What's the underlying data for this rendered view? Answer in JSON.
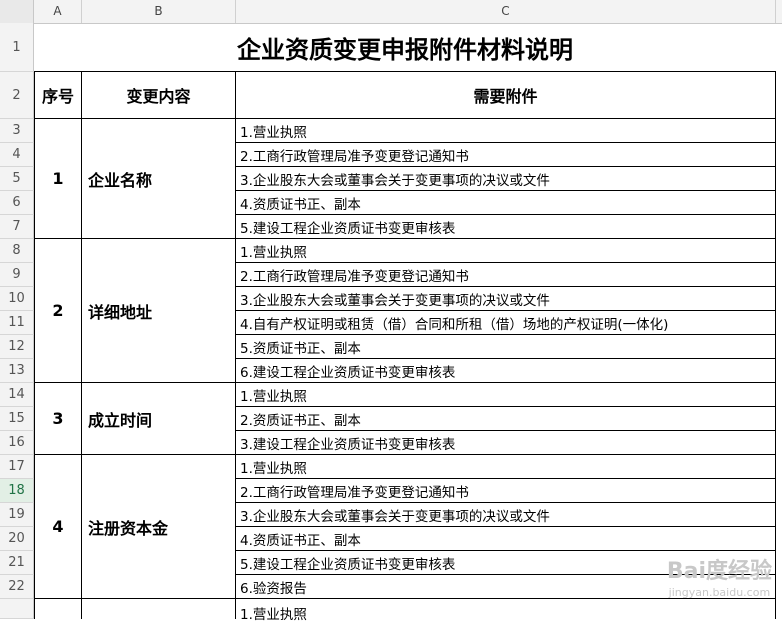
{
  "columns": [
    "A",
    "B",
    "C"
  ],
  "row_numbers": [
    "1",
    "2",
    "3",
    "4",
    "5",
    "6",
    "7",
    "8",
    "9",
    "10",
    "11",
    "12",
    "13",
    "14",
    "15",
    "16",
    "17",
    "18",
    "19",
    "20",
    "21",
    "22"
  ],
  "selected_row": "18",
  "title": "企业资质变更申报附件材料说明",
  "headers": {
    "idx": "序号",
    "content": "变更内容",
    "attach": "需要附件"
  },
  "groups": [
    {
      "idx": "1",
      "name": "企业名称",
      "items": [
        "1.营业执照",
        "2.工商行政管理局准予变更登记通知书",
        "3.企业股东大会或董事会关于变更事项的决议或文件",
        "4.资质证书正、副本",
        "5.建设工程企业资质证书变更审核表"
      ]
    },
    {
      "idx": "2",
      "name": "详细地址",
      "items": [
        "1.营业执照",
        "2.工商行政管理局准予变更登记通知书",
        "3.企业股东大会或董事会关于变更事项的决议或文件",
        "4.自有产权证明或租赁（借）合同和所租（借）场地的产权证明(一体化)",
        "5.资质证书正、副本",
        "6.建设工程企业资质证书变更审核表"
      ]
    },
    {
      "idx": "3",
      "name": "成立时间",
      "items": [
        "1.营业执照",
        "2.资质证书正、副本",
        "3.建设工程企业资质证书变更审核表"
      ]
    },
    {
      "idx": "4",
      "name": "注册资本金",
      "items": [
        "1.营业执照",
        "2.工商行政管理局准予变更登记通知书",
        "3.企业股东大会或董事会关于变更事项的决议或文件",
        "4.资质证书正、副本",
        "5.建设工程企业资质证书变更审核表",
        "6.验资报告"
      ]
    }
  ],
  "partial_next": "1.营业执照",
  "watermark": {
    "brand": "Bai度经验",
    "url": "jingyan.baidu.com"
  }
}
